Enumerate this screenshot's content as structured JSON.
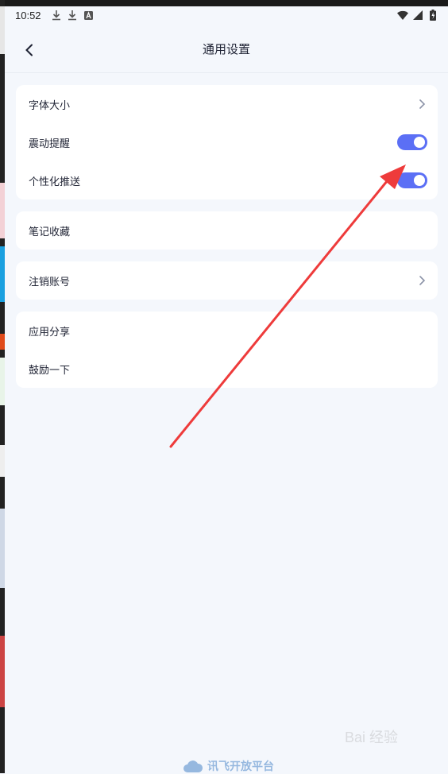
{
  "status_bar": {
    "time": "10:52",
    "left_icons": [
      "download-icon",
      "download-icon",
      "a-badge-icon"
    ],
    "right_icons": [
      "wifi-icon",
      "signal-icon",
      "battery-icon"
    ]
  },
  "nav": {
    "back_icon": "chevron-left-icon",
    "title": "通用设置"
  },
  "groups": [
    {
      "items": [
        {
          "label": "字体大小",
          "control": "chevron"
        },
        {
          "label": "震动提醒",
          "control": "toggle",
          "on": true
        },
        {
          "label": "个性化推送",
          "control": "toggle",
          "on": true
        }
      ]
    },
    {
      "items": [
        {
          "label": "笔记收藏",
          "control": "none"
        }
      ]
    },
    {
      "items": [
        {
          "label": "注销账号",
          "control": "chevron"
        }
      ]
    },
    {
      "items": [
        {
          "label": "应用分享",
          "control": "none"
        },
        {
          "label": "鼓励一下",
          "control": "none"
        }
      ]
    }
  ],
  "colors": {
    "accent": "#5b6ff5",
    "background": "#f4f7fc",
    "card": "#ffffff",
    "annotation_arrow": "#ee3b3b"
  },
  "footer": {
    "logo_text": "讯飞开放平台"
  },
  "watermark": {
    "text": "Bai 经验"
  }
}
